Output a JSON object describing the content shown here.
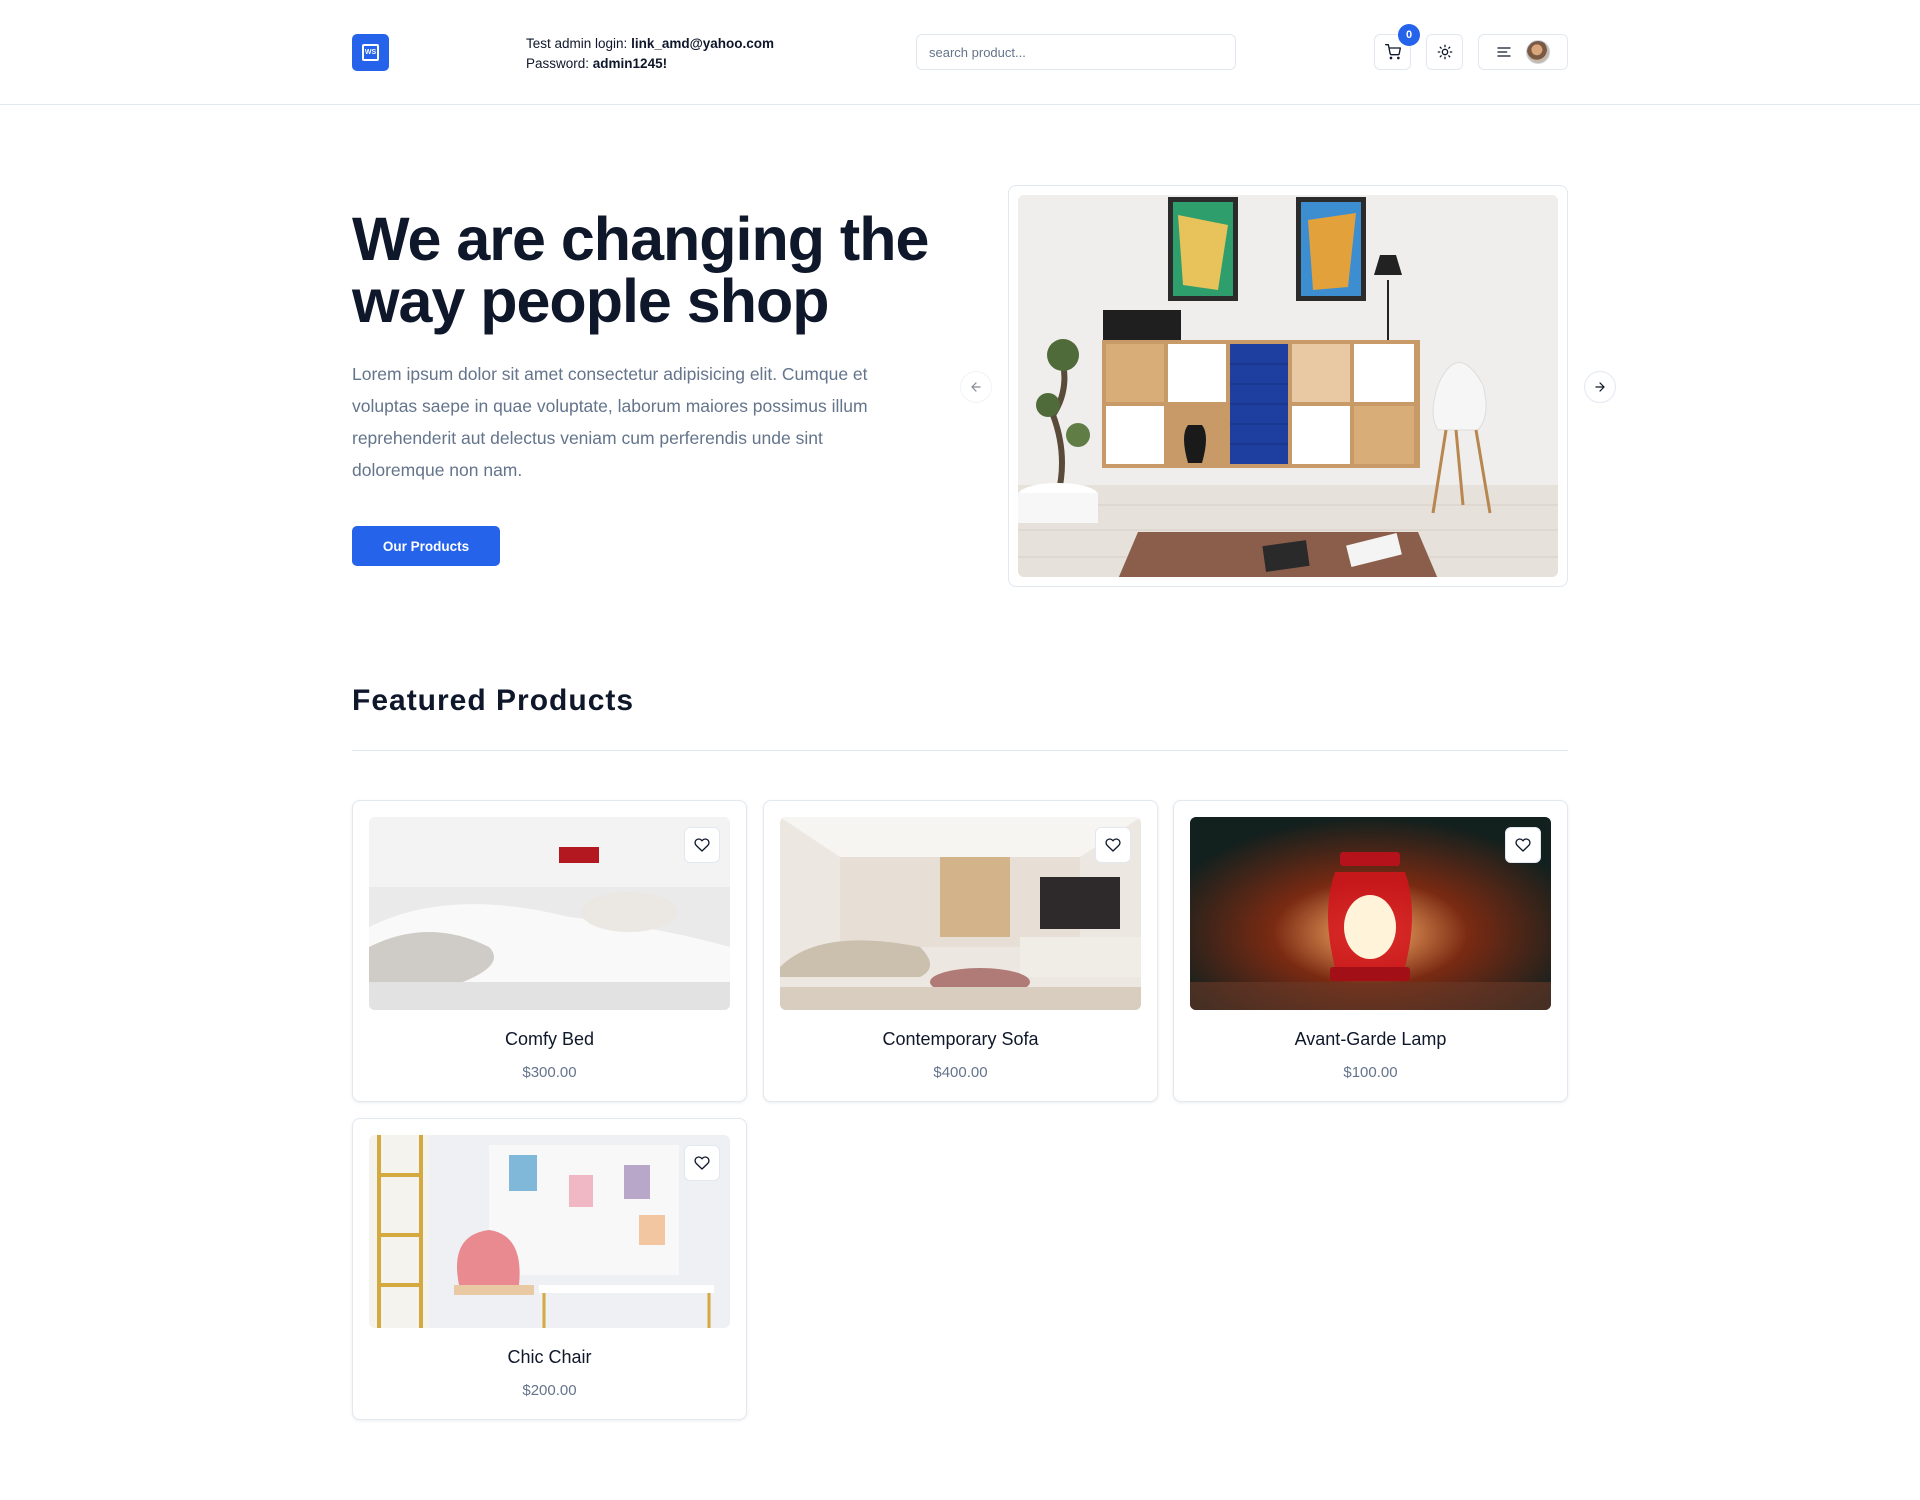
{
  "header": {
    "logo_text": "WS",
    "login_label": "Test admin login:",
    "login_email": "link_amd@yahoo.com",
    "password_label": "Password:",
    "password_value": "admin1245!",
    "search_placeholder": "search product...",
    "cart_count": "0",
    "icons": {
      "cart": "shopping-cart-icon",
      "theme": "sun-icon",
      "menu": "menu-icon",
      "avatar": "user-avatar"
    }
  },
  "hero": {
    "title": "We are changing the way people shop",
    "description": "Lorem ipsum dolor sit amet consectetur adipisicing elit. Cumque et voluptas saepe in quae voluptate, laborum maiores possimus illum reprehenderit aut delectus veniam cum perferendis unde sint doloremque non nam.",
    "button_label": "Our Products"
  },
  "featured": {
    "title": "Featured Products",
    "products": [
      {
        "name": "Comfy Bed",
        "price": "$300.00"
      },
      {
        "name": "Contemporary Sofa",
        "price": "$400.00"
      },
      {
        "name": "Avant-Garde Lamp",
        "price": "$100.00"
      },
      {
        "name": "Chic Chair",
        "price": "$200.00"
      }
    ]
  },
  "colors": {
    "accent": "#2563eb",
    "text": "#0f172a",
    "muted": "#64748b",
    "border": "#e2e8f0"
  }
}
